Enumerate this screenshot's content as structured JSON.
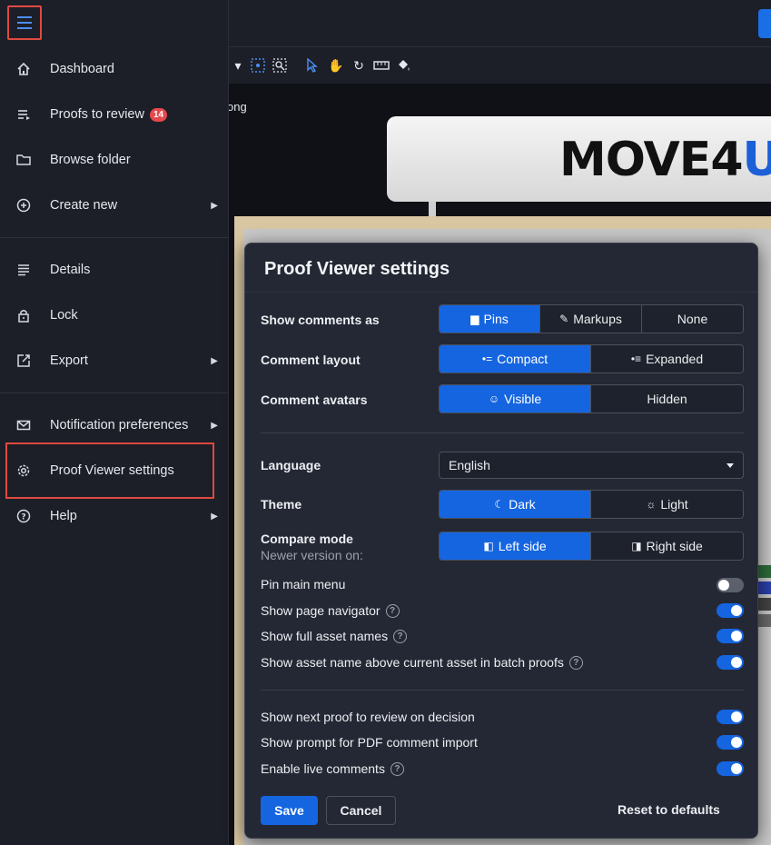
{
  "background": {
    "partial_text": "ong",
    "sign_text_a": "MOVE4",
    "sign_text_b": "U"
  },
  "sidebar": {
    "menu_icon": "hamburger-icon",
    "items": [
      {
        "label": "Dashboard",
        "icon": "home-icon"
      },
      {
        "label": "Proofs to review",
        "icon": "list-icon",
        "badge": "14"
      },
      {
        "label": "Browse folder",
        "icon": "folder-icon"
      },
      {
        "label": "Create new",
        "icon": "plus-circle-icon",
        "submenu": true
      },
      {
        "label": "Details",
        "icon": "details-icon"
      },
      {
        "label": "Lock",
        "icon": "lock-icon"
      },
      {
        "label": "Export",
        "icon": "export-icon",
        "submenu": true
      },
      {
        "label": "Notification preferences",
        "icon": "mail-icon",
        "submenu": true
      },
      {
        "label": "Proof Viewer settings",
        "icon": "gear-icon"
      },
      {
        "label": "Help",
        "icon": "help-icon",
        "submenu": true
      }
    ]
  },
  "settings": {
    "title": "Proof Viewer settings",
    "show_comments_as": {
      "label": "Show comments as",
      "options": [
        "Pins",
        "Markups",
        "None"
      ],
      "selected": "Pins"
    },
    "comment_layout": {
      "label": "Comment layout",
      "options": [
        "Compact",
        "Expanded"
      ],
      "selected": "Compact"
    },
    "comment_avatars": {
      "label": "Comment avatars",
      "options": [
        "Visible",
        "Hidden"
      ],
      "selected": "Visible"
    },
    "language": {
      "label": "Language",
      "value": "English"
    },
    "theme": {
      "label": "Theme",
      "options": [
        "Dark",
        "Light"
      ],
      "selected": "Dark"
    },
    "compare_mode": {
      "label": "Compare mode",
      "sublabel": "Newer version on:",
      "options": [
        "Left side",
        "Right side"
      ],
      "selected": "Left side"
    },
    "toggles": [
      {
        "label": "Pin main menu",
        "on": false,
        "help": false
      },
      {
        "label": "Show page navigator",
        "on": true,
        "help": true
      },
      {
        "label": "Show full asset names",
        "on": true,
        "help": true
      },
      {
        "label": "Show asset name above current asset in batch proofs",
        "on": true,
        "help": true
      },
      {
        "label": "Show next proof to review on decision",
        "on": true,
        "help": false
      },
      {
        "label": "Show prompt for PDF comment import",
        "on": true,
        "help": false
      },
      {
        "label": "Enable live comments",
        "on": true,
        "help": true
      }
    ],
    "save_label": "Save",
    "cancel_label": "Cancel",
    "reset_label": "Reset to defaults"
  },
  "colors": {
    "accent": "#1565e0",
    "highlight": "#e0493f",
    "badge": "#e5484d"
  }
}
